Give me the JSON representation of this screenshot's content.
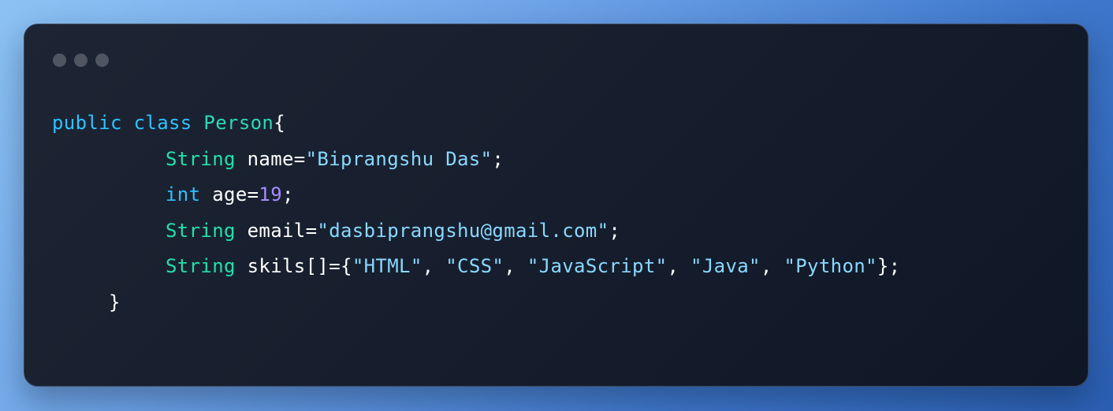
{
  "window": {
    "controls": [
      "dot",
      "dot",
      "dot"
    ]
  },
  "code": {
    "line1": {
      "kw1": "public",
      "sp1": " ",
      "kw2": "class",
      "sp2": " ",
      "cls": "Person",
      "brace": "{"
    },
    "line2": {
      "type": "String",
      "sp": " ",
      "ident": "name=",
      "str": "\"Biprangshu Das\"",
      "semi": ";"
    },
    "line3": {
      "type": "int",
      "sp": " ",
      "ident": "age=",
      "num": "19",
      "semi": ";"
    },
    "line4": {
      "type": "String",
      "sp": " ",
      "ident": "email=",
      "str": "\"dasbiprangshu@gmail.com\"",
      "semi": ";"
    },
    "line5": {
      "type": "String",
      "sp": " ",
      "ident": "skils[]=",
      "open": "{",
      "items": [
        "\"HTML\"",
        "\"CSS\"",
        "\"JavaScript\"",
        "\"Java\"",
        "\"Python\""
      ],
      "sep": ", ",
      "close": "}",
      "semi": ";"
    },
    "line6": {
      "brace": "}"
    }
  }
}
